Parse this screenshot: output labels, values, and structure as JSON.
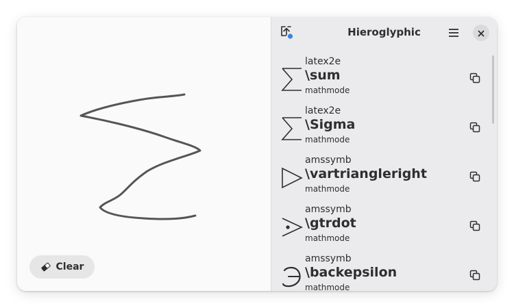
{
  "canvas": {
    "clear_label": "Clear",
    "clear_icon": "eraser-icon"
  },
  "header": {
    "title": "Hieroglyphic",
    "upload_icon": "upload-icon",
    "menu_icon": "hamburger-menu-icon",
    "close_icon": "close-icon",
    "accent_color": "#3584e4"
  },
  "results": [
    {
      "package": "latex2e",
      "command": "\\sum",
      "mode": "mathmode",
      "symbol": "sum-symbol"
    },
    {
      "package": "latex2e",
      "command": "\\Sigma",
      "mode": "mathmode",
      "symbol": "sum-symbol"
    },
    {
      "package": "amssymb",
      "command": "\\vartriangleright",
      "mode": "mathmode",
      "symbol": "vartriangleright-symbol"
    },
    {
      "package": "amssymb",
      "command": "\\gtrdot",
      "mode": "mathmode",
      "symbol": "gtrdot-symbol"
    },
    {
      "package": "amssymb",
      "command": "\\backepsilon",
      "mode": "mathmode",
      "symbol": "backepsilon-symbol"
    }
  ]
}
